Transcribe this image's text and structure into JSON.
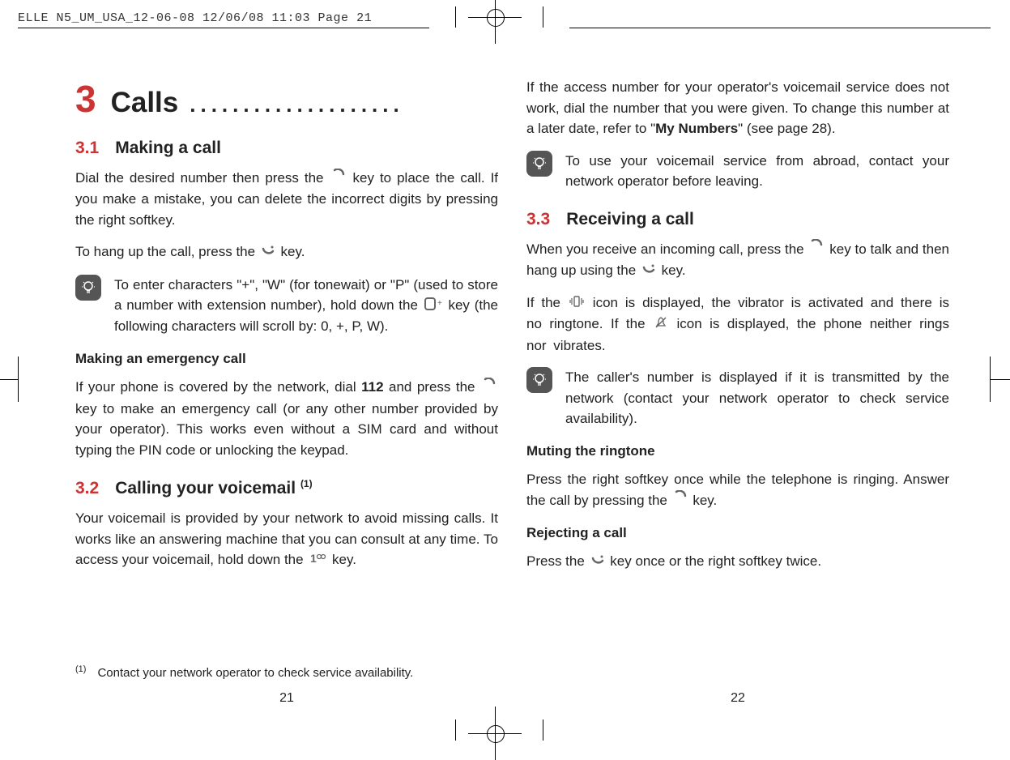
{
  "print_header": "ELLE N5_UM_USA_12-06-08  12/06/08  11:03  Page 21",
  "chapter": {
    "num": "3",
    "title": "Calls"
  },
  "left": {
    "s1": {
      "num": "3.1",
      "title": "Making a call"
    },
    "p1a": "Dial the desired number then press the ",
    "p1b": " key to place the call. If you make a mistake, you can delete the incorrect digits by pressing the right softkey.",
    "p2a": "To hang up the call, press the ",
    "p2b": " key.",
    "tip1a": "To enter characters \"+\", \"W\" (for tonewait) or \"P\" (used to store a number with extension number), hold down the ",
    "tip1b": " key (the following characters will scroll by: 0, +, P, W).",
    "sub1": "Making an emergency call",
    "p3a": "If your phone is covered by the network, dial ",
    "p3bold": "112",
    "p3b": " and press the ",
    "p3c": " key to make an emergency call (or any other number provided by your operator). This works even without a SIM card and without typing the PIN code or unlocking the keypad.",
    "s2": {
      "num": "3.2",
      "title": "Calling your voicemail ",
      "sup": "(1)"
    },
    "p4a": "Your voicemail is provided by your network to avoid missing calls. It works like an answering machine that you can consult at any time. To access your voicemail, hold down the ",
    "p4b": " key.",
    "footnote_sup": "(1)",
    "footnote": "Contact your network operator to check service availability.",
    "pagenum": "21"
  },
  "right": {
    "p1a": "If the access number for your operator's voicemail service does not work, dial the number that you were given. To change this number at a later date, refer to \"",
    "p1bold": "My Numbers",
    "p1b": "\" (see page 28).",
    "tip1": "To use your voicemail service from abroad, contact your network operator before leaving.",
    "s3": {
      "num": "3.3",
      "title": "Receiving a call"
    },
    "p2a": "When you receive an incoming call, press the ",
    "p2b": " key to talk and then hang up using the ",
    "p2c": " key.",
    "p3a": "If the ",
    "p3b": " icon is displayed, the vibrator is activated and there is no ringtone. If the ",
    "p3c": " icon is displayed, the phone neither rings nor vibrates.",
    "tip2": "The caller's number is displayed if it is transmitted by the network (contact your network operator to check service availability).",
    "sub1": "Muting the ringtone",
    "p4a": "Press the right softkey once while the telephone is ringing. Answer the call by pressing the ",
    "p4b": " key.",
    "sub2": "Rejecting a call",
    "p5a": "Press the ",
    "p5b": " key once or the right softkey twice.",
    "pagenum": "22"
  }
}
